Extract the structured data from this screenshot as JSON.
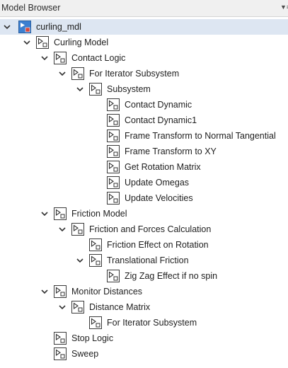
{
  "panel": {
    "title": "Model Browser",
    "menu_icon": "dropdown-menu-icon"
  },
  "tree": {
    "nodes": [
      {
        "label": "curling_mdl",
        "icon": "model-icon",
        "expanded": true,
        "selected": true
      },
      {
        "label": "Curling Model",
        "icon": "subsystem-icon",
        "expanded": true
      },
      {
        "label": "Contact Logic",
        "icon": "subsystem-icon",
        "expanded": true
      },
      {
        "label": "For Iterator Subsystem",
        "icon": "subsystem-icon",
        "expanded": true
      },
      {
        "label": "Subsystem",
        "icon": "subsystem-icon",
        "expanded": true
      },
      {
        "label": "Contact Dynamic",
        "icon": "subsystem-icon"
      },
      {
        "label": "Contact Dynamic1",
        "icon": "subsystem-icon"
      },
      {
        "label": "Frame Transform to Normal Tangential",
        "icon": "subsystem-icon"
      },
      {
        "label": "Frame Transform to XY",
        "icon": "subsystem-icon"
      },
      {
        "label": "Get Rotation Matrix",
        "icon": "subsystem-icon"
      },
      {
        "label": "Update Omegas",
        "icon": "subsystem-icon"
      },
      {
        "label": "Update Velocities",
        "icon": "subsystem-icon"
      },
      {
        "label": "Friction Model",
        "icon": "subsystem-icon",
        "expanded": true
      },
      {
        "label": "Friction and Forces Calculation",
        "icon": "subsystem-icon",
        "expanded": true
      },
      {
        "label": "Friction Effect on Rotation",
        "icon": "subsystem-icon"
      },
      {
        "label": "Translational Friction",
        "icon": "subsystem-icon",
        "expanded": true
      },
      {
        "label": "Zig Zag Effect if no spin",
        "icon": "subsystem-icon"
      },
      {
        "label": "Monitor Distances",
        "icon": "subsystem-icon",
        "expanded": true
      },
      {
        "label": "Distance Matrix",
        "icon": "subsystem-icon",
        "expanded": true
      },
      {
        "label": "For Iterator Subsystem",
        "icon": "subsystem-icon"
      },
      {
        "label": "Stop Logic",
        "icon": "subsystem-icon"
      },
      {
        "label": "Sweep",
        "icon": "subsystem-icon"
      }
    ]
  },
  "colors": {
    "header_bg": "#f0f0f0",
    "selected_row_bg": "#dde6f2",
    "model_icon_blue": "#3c7fd0",
    "model_icon_red": "#d9453a",
    "icon_border": "#3a3a3a"
  }
}
